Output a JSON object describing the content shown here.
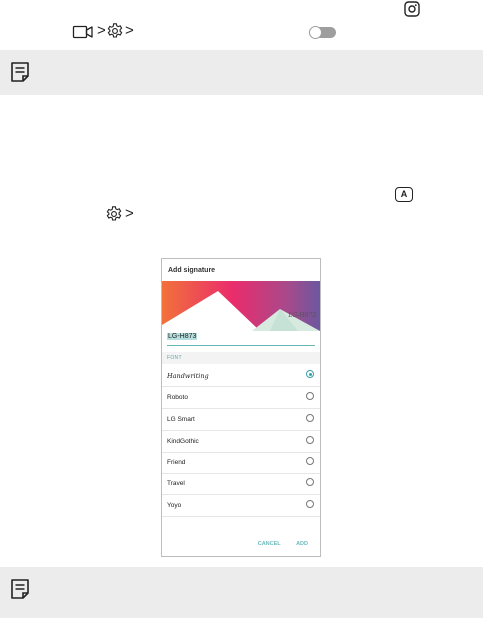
{
  "page": {
    "bg": "#ffffff",
    "note_bg": "#ececec",
    "toggle_color": "#9e9e9e",
    "accent": "#3a9fa8"
  },
  "icons": {
    "instagram": "instagram-icon",
    "video": "video-camera-icon",
    "settings": "gear-icon",
    "toggle": "toggle-switch-off",
    "note": "note-icon",
    "signature": "a-letter-key-icon"
  },
  "glyphs": {
    "chevron": ">",
    "letter_a": "A"
  },
  "dialog": {
    "title": "Add signature",
    "signature_overlay": "LG-H873",
    "name_value": "LG-H873",
    "font_header": "FONT",
    "fonts": [
      {
        "label": "Handwriting",
        "selected": true
      },
      {
        "label": "Roboto",
        "selected": false
      },
      {
        "label": "LG Smart",
        "selected": false
      },
      {
        "label": "KindGothic",
        "selected": false
      },
      {
        "label": "Friend",
        "selected": false
      },
      {
        "label": "Travel",
        "selected": false
      },
      {
        "label": "Yoyo",
        "selected": false
      }
    ],
    "cancel_label": "CANCEL",
    "add_label": "ADD"
  }
}
